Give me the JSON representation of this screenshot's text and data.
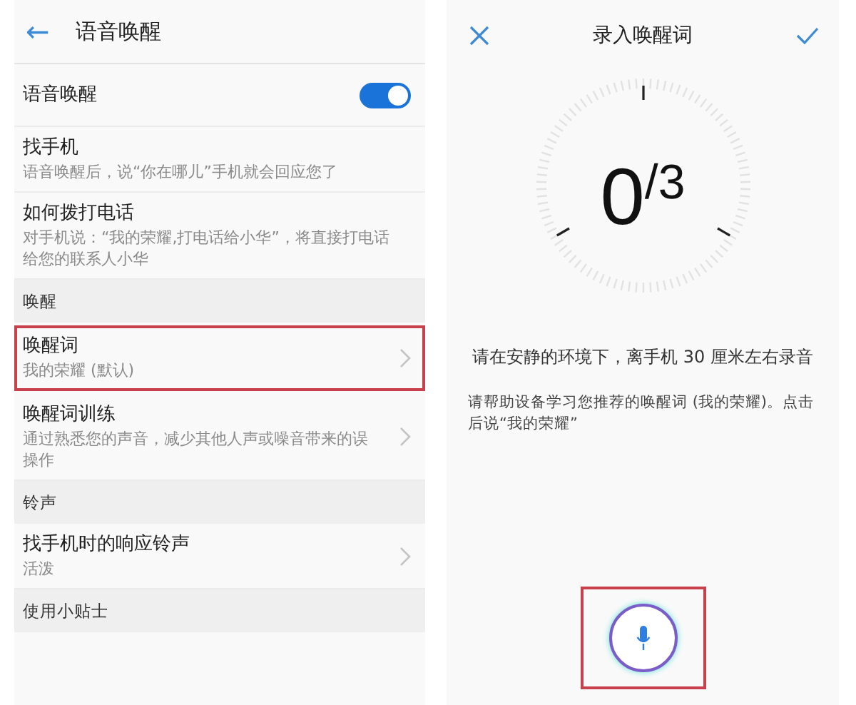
{
  "left_screen": {
    "header": {
      "back_icon": "←",
      "title": "语音唤醒"
    },
    "items": [
      {
        "kind": "toggle",
        "title": "语音唤醒",
        "on": true
      },
      {
        "kind": "item",
        "title": "找手机",
        "subtitle": "语音唤醒后，说“你在哪儿”手机就会回应您了"
      },
      {
        "kind": "item",
        "title": "如何拨打电话",
        "subtitle": "对手机说：“我的荣耀,打电话给小华”，将直接打电话给您的联系人小华"
      },
      {
        "kind": "section",
        "title": "唤醒"
      },
      {
        "kind": "link",
        "title": "唤醒词",
        "subtitle": "我的荣耀 (默认)",
        "highlighted": true
      },
      {
        "kind": "link",
        "title": "唤醒词训练",
        "subtitle": "通过熟悉您的声音，减少其他人声或噪音带来的误操作",
        "highlighted": false
      },
      {
        "kind": "section",
        "title": "铃声"
      },
      {
        "kind": "link",
        "title": "找手机时的响应铃声",
        "subtitle": "活泼",
        "highlighted": false
      },
      {
        "kind": "section",
        "title": "使用小贴士"
      }
    ]
  },
  "right_screen": {
    "header": {
      "title": "录入唤醒词"
    },
    "counter": "0$^{/3}$",
    "instruction": "请在安静的环境下，离手机 30 厘米左右录音",
    "hint": "请帮助设备学习您推荐的唤醒词 (我的荣耀)。点击后说“我的荣耀”",
    "mic_highlighted": true
  }
}
